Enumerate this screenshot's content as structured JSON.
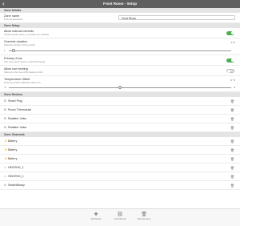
{
  "app": {
    "title": "Front Room - Setup",
    "back_icon": "chevron-left-icon"
  },
  "zone_details": {
    "header": "Zone Details",
    "zone_name_label": "Zone name",
    "zone_name_sub": "Zone set description",
    "zone_name_value": "Front Room"
  },
  "zone_setup": {
    "header": "Zone Setup",
    "manual_override": {
      "label": "Allow manual override",
      "sub": "Controls gentle rooms, or override your schedule",
      "on": true
    },
    "override_duration": {
      "label": "Override duration",
      "sub": "Adjust the duration of the override",
      "min": "1",
      "value": "1 hr",
      "fraction": 0.02
    },
    "primary_zone": {
      "label": "Primary Zone",
      "sub": "This zone can be used to control the heating",
      "on": true
    },
    "allow_use_heating": {
      "label": "Allow use heating",
      "sub": "Allow up to the zone of the heating control",
      "on": false
    },
    "temperature_offset": {
      "label": "Temperature Offset",
      "sub": "Zone temperature calibration offset (°C)",
      "min": "-5",
      "max": "5",
      "value": "0 °C",
      "fraction": 0.5
    }
  },
  "zone_devices": {
    "header": "Zone Devices",
    "items": [
      {
        "name": "Smart Plug",
        "icon": "plug-icon"
      },
      {
        "name": "Room Thermostat",
        "icon": "thermostat-icon"
      },
      {
        "name": "Radiator Valve",
        "icon": "valve-icon"
      },
      {
        "name": "Radiator Valve",
        "icon": "valve-icon"
      }
    ]
  },
  "zone_channels": {
    "header": "Zone Channels",
    "items": [
      {
        "name": "Battery",
        "icon": "battery-icon"
      },
      {
        "name": "Battery",
        "icon": "battery-icon"
      },
      {
        "name": "Battery",
        "icon": "battery-icon"
      },
      {
        "name": "HEATING_1",
        "icon": "flame-icon"
      },
      {
        "name": "HEATING_1",
        "icon": "flame-icon"
      },
      {
        "name": "SwitchBinary",
        "icon": "switch-icon"
      }
    ]
  },
  "toolbar": [
    {
      "label": "Add Device",
      "icon": "plus-icon"
    },
    {
      "label": "Link Channel",
      "icon": "link-icon"
    },
    {
      "label": "Remove Zone",
      "icon": "trash-icon"
    }
  ]
}
